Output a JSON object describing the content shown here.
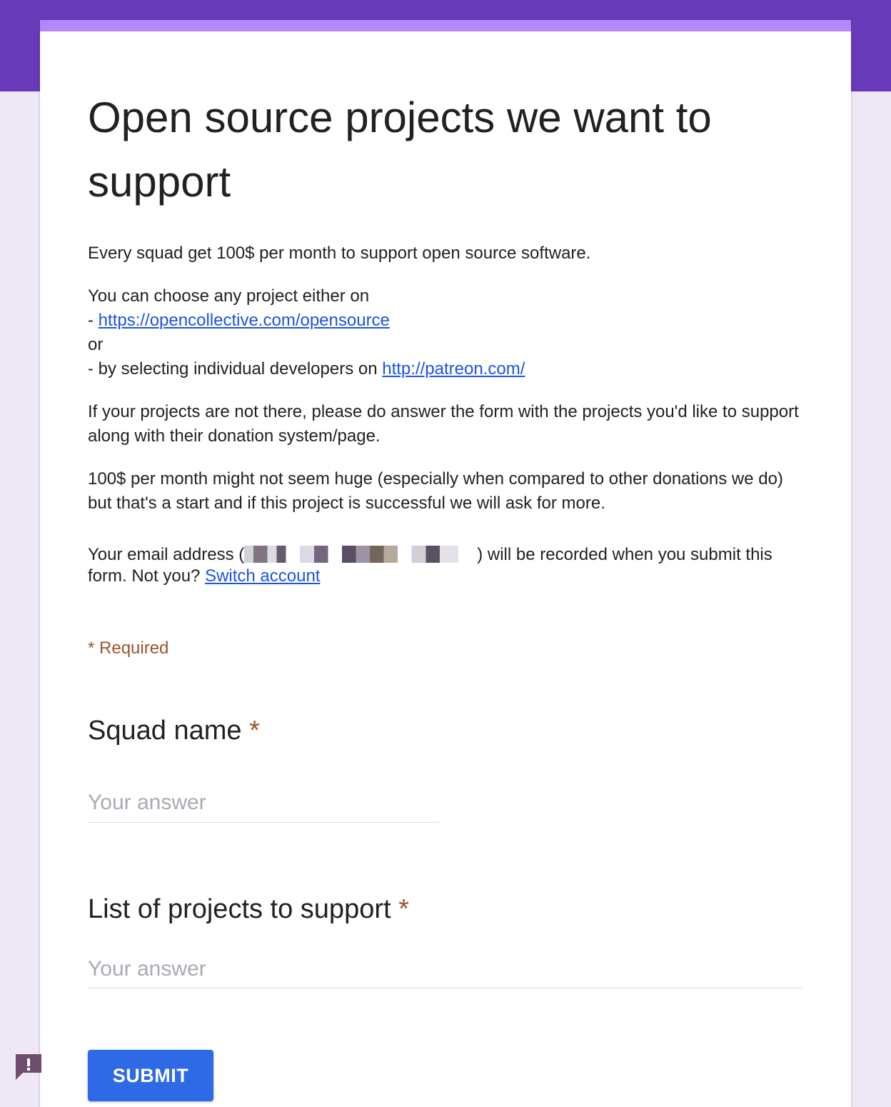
{
  "form": {
    "title": "Open source projects we want to support",
    "description": {
      "p1": "Every squad get 100$ per month to support open source software.",
      "p2_intro": "You can choose any project either on",
      "p2_dash1": "- ",
      "p2_link1": "https://opencollective.com/opensource",
      "p2_or": "or",
      "p2_dash2": "- by selecting individual developers on ",
      "p2_link2": "http://patreon.com/",
      "p3": "If your projects are not there, please do answer the form with the projects you'd like to support along with their donation system/page.",
      "p4": "100$ per month might not seem huge (especially when compared to other donations we do)  but that's a start and if this project is successful we will ask for more."
    },
    "email_notice": {
      "prefix": "Your email address (",
      "suffix": ") will be recorded when you submit this form. Not you? ",
      "switch_link": "Switch account"
    },
    "required_note": "* Required",
    "questions": [
      {
        "label": "Squad name",
        "required_mark": "*",
        "placeholder": "Your answer"
      },
      {
        "label": "List of projects to support",
        "required_mark": "*",
        "placeholder": "Your answer"
      }
    ],
    "submit_label": "SUBMIT"
  },
  "colors": {
    "header": "#673ab7",
    "accent": "#b388ff",
    "background": "#ede7f6",
    "link": "#1a53e8",
    "required": "#a0522d",
    "submit": "#2f6ae6"
  },
  "icons": {
    "feedback": "report-feedback-icon"
  }
}
